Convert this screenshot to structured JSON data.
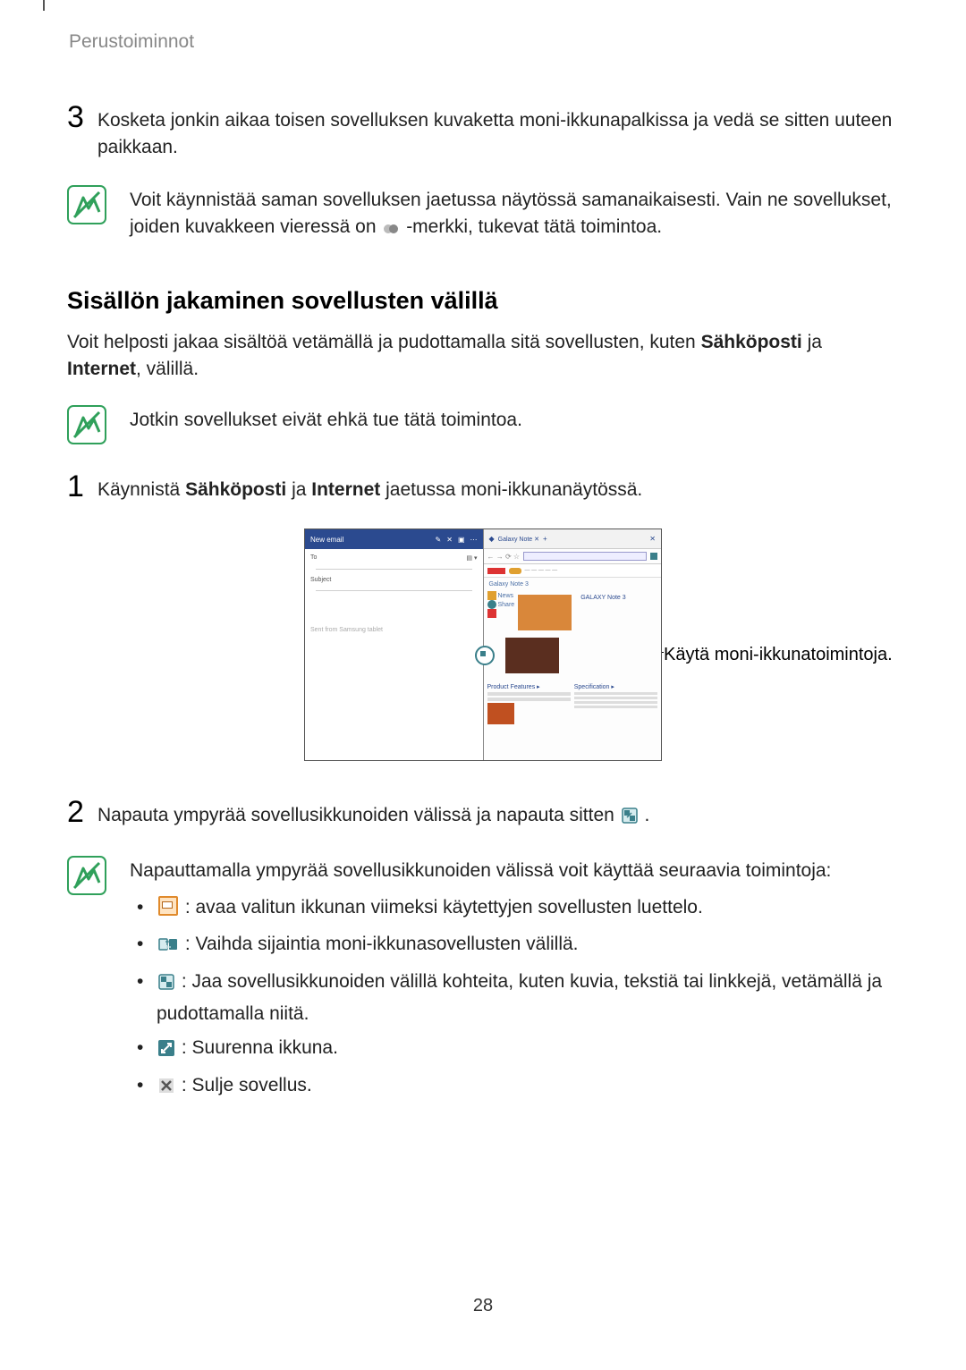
{
  "header": "Perustoiminnot",
  "step3": {
    "number": "3",
    "text": "Kosketa jonkin aikaa toisen sovelluksen kuvaketta moni-ikkunapalkissa ja vedä se sitten uuteen paikkaan."
  },
  "note1": {
    "line1": "Voit käynnistää saman sovelluksen jaetussa näytössä samanaikaisesti. Vain ne sovellukset, joiden kuvakkeen vieressä on ",
    "line2": "-merkki, tukevat tätä toimintoa."
  },
  "section_heading": "Sisällön jakaminen sovellusten välillä",
  "intro_para": {
    "part1": "Voit helposti jakaa sisältöä vetämällä ja pudottamalla sitä sovellusten, kuten ",
    "bold1": "Sähköposti",
    "part2": " ja ",
    "bold2": "Internet",
    "part3": ", välillä."
  },
  "note2": {
    "text": "Jotkin sovellukset eivät ehkä tue tätä toimintoa."
  },
  "step1": {
    "number": "1",
    "part1": "Käynnistä ",
    "bold1": "Sähköposti",
    "part2": " ja ",
    "bold2": "Internet",
    "part3": " jaetussa moni-ikkunanäytössä."
  },
  "figure_callout": "Käytä moni-ikkunatoimintoja.",
  "step2": {
    "number": "2",
    "part1": "Napauta ympyrää sovellusikkunoiden välissä ja napauta sitten ",
    "part2": "."
  },
  "note3": {
    "intro": "Napauttamalla ympyrää sovellusikkunoiden välissä voit käyttää seuraavia toimintoja:",
    "bullets": [
      " : avaa valitun ikkunan viimeksi käytettyjen sovellusten luettelo.",
      " : Vaihda sijaintia moni-ikkunasovellusten välillä.",
      " : Jaa sovellusikkunoiden välillä kohteita, kuten kuvia, tekstiä tai linkkejä, vetämällä ja pudottamalla niitä.",
      " : Suurenna ikkuna.",
      " : Sulje sovellus."
    ]
  },
  "page_number": "28"
}
